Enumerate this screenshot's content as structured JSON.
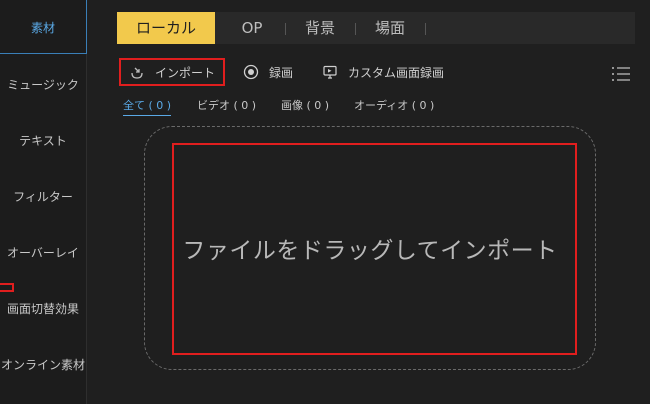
{
  "sidebar": {
    "items": [
      {
        "label": "素材",
        "active": true
      },
      {
        "label": "ミュージック"
      },
      {
        "label": "テキスト"
      },
      {
        "label": "フィルター"
      },
      {
        "label": "オーバーレイ"
      },
      {
        "label": "画面切替効果"
      },
      {
        "label": "オンライン素材"
      }
    ]
  },
  "tabs": [
    {
      "label": "ローカル",
      "active": true
    },
    {
      "label": "OP"
    },
    {
      "label": "背景"
    },
    {
      "label": "場面"
    }
  ],
  "toolbar": {
    "import_label": "インポート",
    "record_label": "録画",
    "custom_record_label": "カスタム画面録画"
  },
  "filters": [
    {
      "label": "全て ( 0 )",
      "active": true
    },
    {
      "label": "ビデオ ( 0 )"
    },
    {
      "label": "画像 ( 0 )"
    },
    {
      "label": "オーディオ ( 0 )"
    }
  ],
  "dropzone": {
    "text": "ファイルをドラッグしてインポート"
  },
  "colors": {
    "accent": "#5aa9e6",
    "tab_active": "#f2c94c",
    "highlight": "#e01e1e"
  }
}
